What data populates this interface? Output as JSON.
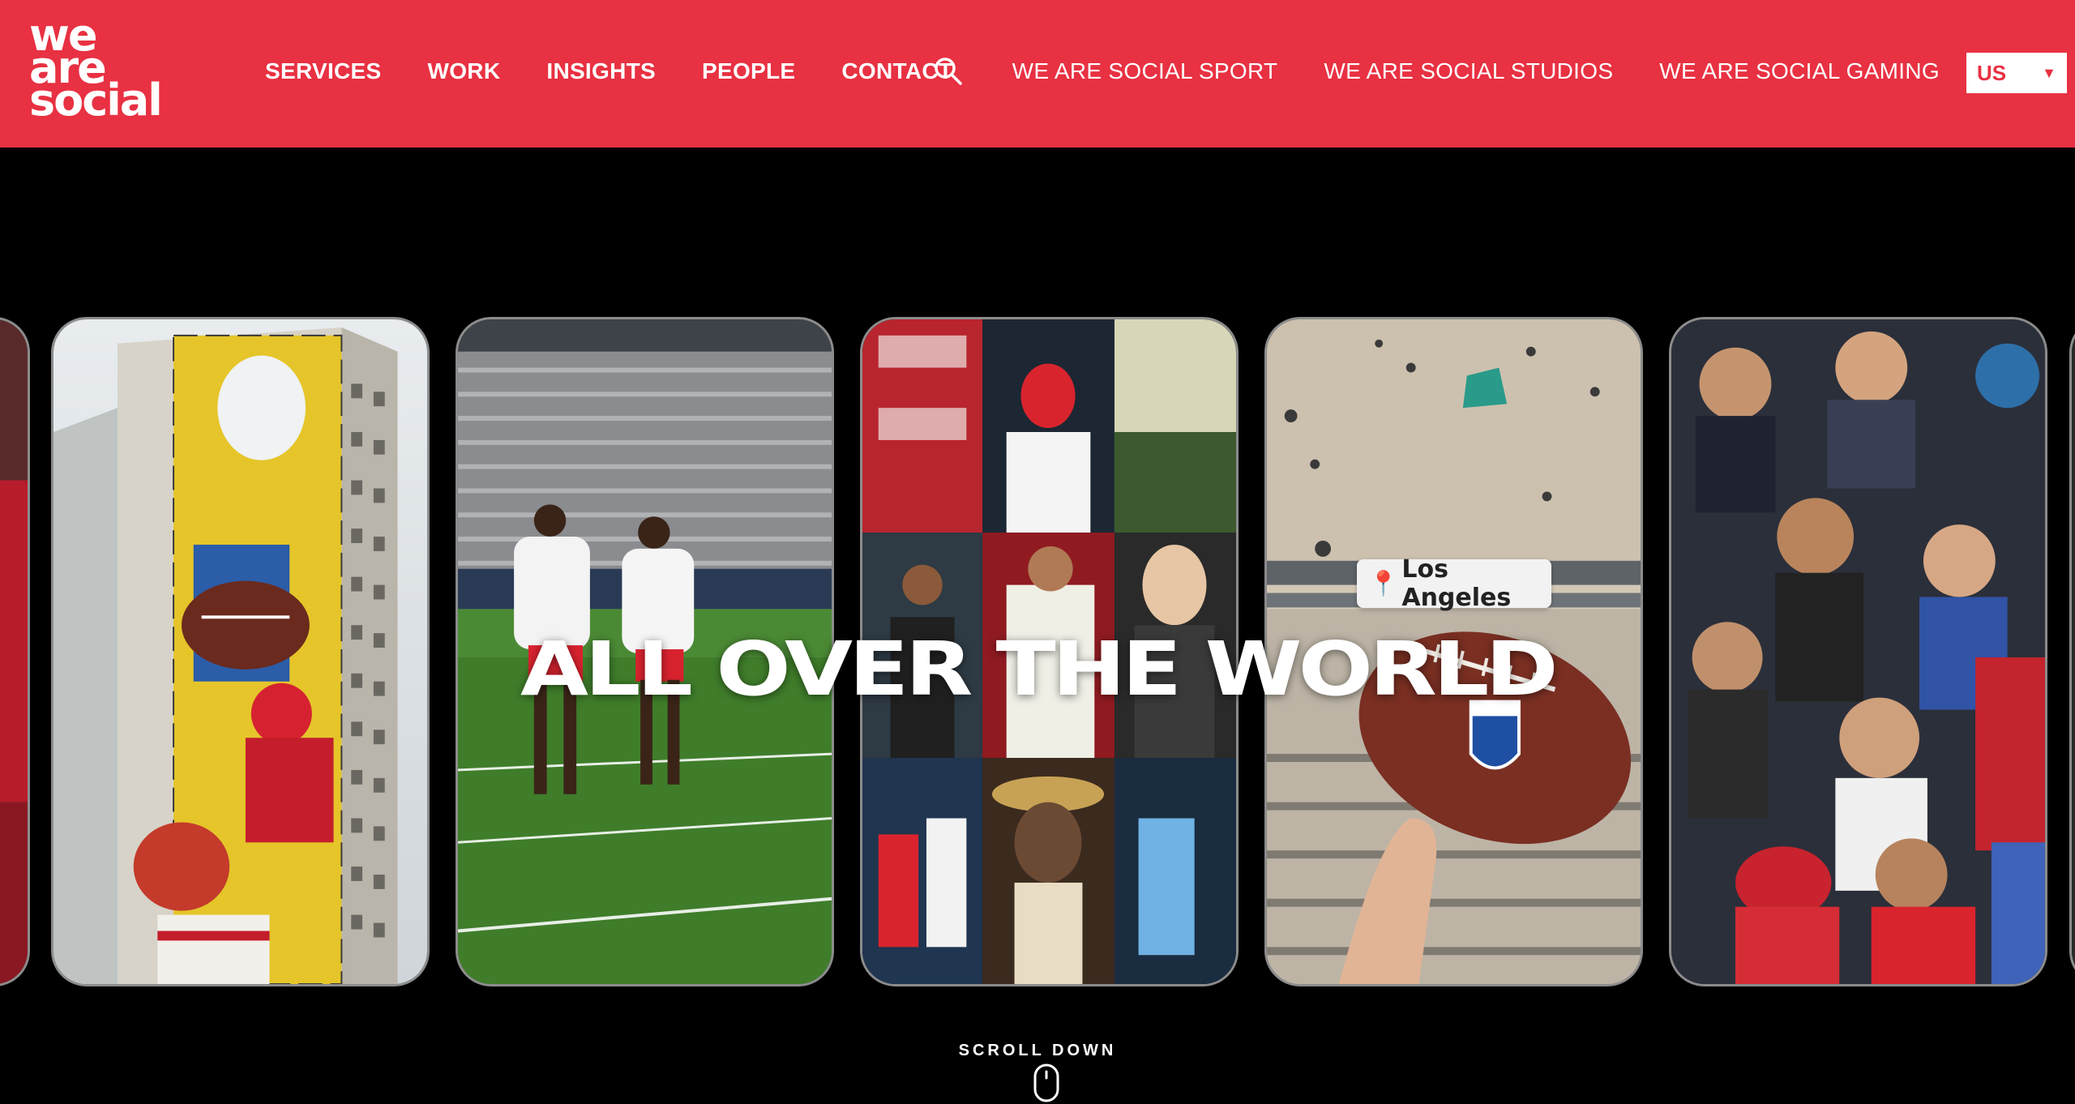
{
  "brand": {
    "logo_lines": [
      "we",
      "are",
      "social"
    ],
    "color": "#e83142"
  },
  "nav": {
    "main": [
      "SERVICES",
      "WORK",
      "INSIGHTS",
      "PEOPLE",
      "CONTACT"
    ],
    "search_icon": "search-icon",
    "sister_sites": [
      "WE ARE SOCIAL SPORT",
      "WE ARE SOCIAL STUDIOS",
      "WE ARE SOCIAL GAMING"
    ],
    "region": {
      "selected": "US",
      "icon": "caret-down-icon"
    }
  },
  "hero": {
    "headline": "ALL OVER THE WORLD",
    "location_tag": "Los Angeles",
    "location_icon": "map-pin-icon",
    "scroll_label": "SCROLL DOWN",
    "scroll_icon": "mouse-icon"
  }
}
